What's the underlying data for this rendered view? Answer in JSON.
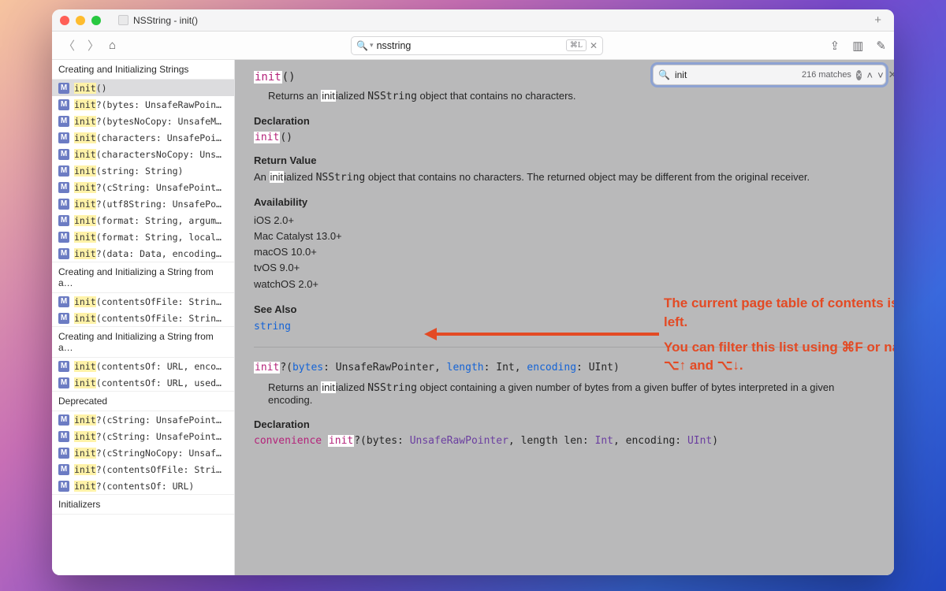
{
  "window": {
    "title": "NSString - init()"
  },
  "toolbar": {
    "search_value": "nsstring",
    "search_shortcut": "⌘L"
  },
  "findbar": {
    "value": "init",
    "matches": "216 matches"
  },
  "sidebar": {
    "sections": [
      {
        "title": "Creating and Initializing Strings",
        "items": [
          {
            "sig": "init()",
            "selected": true
          },
          {
            "sig": "init?(bytes: UnsafeRawPoin…"
          },
          {
            "sig": "init?(bytesNoCopy: UnsafeM…"
          },
          {
            "sig": "init(characters: UnsafePoi…"
          },
          {
            "sig": "init(charactersNoCopy: Uns…"
          },
          {
            "sig": "init(string: String)"
          },
          {
            "sig": "init?(cString: UnsafePoint…"
          },
          {
            "sig": "init?(utf8String: UnsafePo…"
          },
          {
            "sig": "init(format: String, argum…"
          },
          {
            "sig": "init(format: String, local…"
          },
          {
            "sig": "init?(data: Data, encoding…"
          }
        ]
      },
      {
        "title": "Creating and Initializing a String from a…",
        "items": [
          {
            "sig": "init(contentsOfFile: Strin…"
          },
          {
            "sig": "init(contentsOfFile: Strin…"
          }
        ]
      },
      {
        "title": "Creating and Initializing a String from a…",
        "items": [
          {
            "sig": "init(contentsOf: URL, enco…"
          },
          {
            "sig": "init(contentsOf: URL, used…"
          }
        ]
      },
      {
        "title": "Deprecated",
        "items": [
          {
            "sig": "init?(cString: UnsafePoint…"
          },
          {
            "sig": "init?(cString: UnsafePoint…"
          },
          {
            "sig": "init?(cStringNoCopy: Unsaf…"
          },
          {
            "sig": "init?(contentsOfFile: Stri…"
          },
          {
            "sig": "init?(contentsOf: URL)"
          }
        ]
      },
      {
        "title": "Initializers",
        "items": []
      }
    ]
  },
  "doc": {
    "m1": {
      "title_prefix": "init",
      "title_suffix": "()",
      "summary_pre": "Returns an ",
      "summary_hi": "init",
      "summary_mid": "ialized ",
      "summary_code": "NSString",
      "summary_post": " object that contains no characters.",
      "decl_label": "Declaration",
      "decl_prefix": "init",
      "decl_suffix": "()",
      "rv_label": "Return Value",
      "rv_pre": "An ",
      "rv_hi": "init",
      "rv_mid": "ialized ",
      "rv_code": "NSString",
      "rv_post": " object that contains no characters. The returned object may be different from the original receiver.",
      "avail_label": "Availability",
      "avail": [
        "iOS 2.0+",
        "Mac Catalyst 13.0+",
        "macOS 10.0+",
        "tvOS 9.0+",
        "watchOS 2.0+"
      ],
      "seealso_label": "See Also",
      "seealso_link": "string"
    },
    "m2": {
      "sig_pre": "init",
      "sig_q": "?(",
      "p1": "bytes",
      "t1": ": UnsafeRawPointer, ",
      "p2": "length",
      "t2": ": Int, ",
      "p3": "encoding",
      "t3": ": UInt)",
      "summary_pre": "Returns an ",
      "summary_hi": "init",
      "summary_mid": "ialized ",
      "summary_code": "NSString",
      "summary_post": " object containing a given number of bytes from a given buffer of bytes interpreted in a given encoding.",
      "decl_label": "Declaration",
      "decl": "convenience init?(bytes: UnsafeRawPointer, length len: Int, encoding: UInt)"
    }
  },
  "annotation": {
    "line1": "The current page table of contents is shown on the left.",
    "line2": "You can filter this list using ⌘F or navigate it using ⌥↑ and ⌥↓."
  }
}
